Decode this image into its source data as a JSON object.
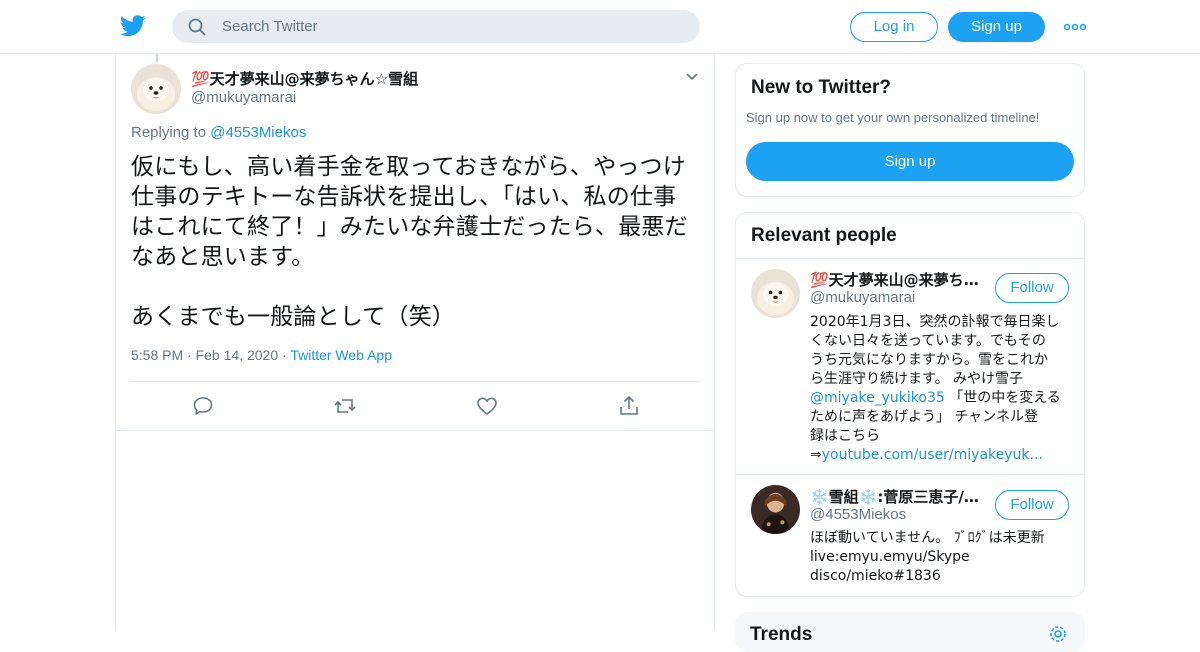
{
  "topbar": {
    "logo_icon": "twitter-bird-icon",
    "search_placeholder": "Search Twitter",
    "login_label": "Log in",
    "signup_label": "Sign up",
    "more_icon": "more-dots-icon",
    "brand_color": "#1da1f2"
  },
  "tweet": {
    "display_name": "💯天才夢来山@来夢ちゃん☆雪組",
    "handle": "@mukuyamarai",
    "replying_prefix": "Replying to",
    "replying_to": "@4553Miekos",
    "text": "仮にもし、高い着手金を取っておきながら、やっつけ\n仕事のテキトーな告訴状を提出し、「はい、私の仕事\nはこれにて終了！」みたいな弁護士だったら、最悪だ\nなあと思います。\n\nあくまでも一般論として（笑）",
    "time": "5:58 PM",
    "sep": "·",
    "date": "Feb 14, 2020",
    "source": "Twitter Web App",
    "actions": [
      "reply-icon",
      "retweet-icon",
      "like-icon",
      "share-icon"
    ]
  },
  "sidebar": {
    "new_to_twitter": {
      "title": "New to Twitter?",
      "subtitle": "Sign up now to get your own personalized timeline!",
      "button": "Sign up"
    },
    "relevant_people": {
      "title": "Relevant people",
      "people": [
        {
          "name": "💯天才夢来山@来夢ちゃん☆雪組",
          "handle": "@mukuyamarai",
          "follow": "Follow",
          "bio_text": "2020年1月3日、突然の訃報で毎日楽し\nくない日々を送っています。でもその\nうち元気になりますから。雪をこれか\nら生涯守り続けます。 みやけ雪子\n",
          "bio_link1": "@miyake_yukiko35",
          "bio_text2": " 「世の中を変える\nために声をあげよう」 チャンネル登\n録はこちら\n⇒",
          "bio_link2": "youtube.com/user/miyakeyuk..."
        },
        {
          "name": "❄️雪組❄️:菅原三恵子/Mieko",
          "handle": "@4553Miekos",
          "follow": "Follow",
          "bio_text": "ほぼ動いていません。 ﾌﾞﾛｸﾞは未更新\nlive:emyu.emyu/Skype\ndisco/mieko#1836"
        }
      ]
    },
    "trends": {
      "title": "Trends",
      "icon": "gear-icon"
    }
  }
}
